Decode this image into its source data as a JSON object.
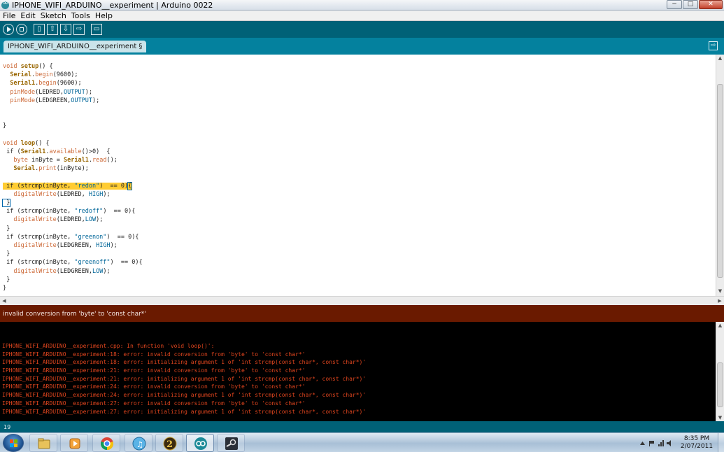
{
  "window": {
    "title": "IPHONE_WIFI_ARDUINO__experiment | Arduino 0022",
    "minimize": "−",
    "maximize": "□",
    "close": "✕"
  },
  "menu": [
    "File",
    "Edit",
    "Sketch",
    "Tools",
    "Help"
  ],
  "toolbar": {
    "icons": [
      "verify-icon",
      "stop-icon",
      "new-icon",
      "open-icon",
      "save-icon",
      "upload-icon",
      "serial-monitor-icon"
    ]
  },
  "tab": {
    "label": "IPHONE_WIFI_ARDUINO__experiment §"
  },
  "code": {
    "l1_a": "void ",
    "l1_b": "setup",
    "l1_c": "() {",
    "l2_a": "  ",
    "l2_b": "Serial",
    "l2_c": ".",
    "l2_d": "begin",
    "l2_e": "(9600);",
    "l3_a": "  ",
    "l3_b": "Serial1",
    "l3_c": ".",
    "l3_d": "begin",
    "l3_e": "(9600);",
    "l4_a": "  ",
    "l4_b": "pinMode",
    "l4_c": "(LEDRED,",
    "l4_d": "OUTPUT",
    "l4_e": ");",
    "l5_a": "  ",
    "l5_b": "pinMode",
    "l5_c": "(LEDGREEN,",
    "l5_d": "OUTPUT",
    "l5_e": ");",
    "l8": "}",
    "l10_a": "void ",
    "l10_b": "loop",
    "l10_c": "() {",
    "l11_a": " if (",
    "l11_b": "Serial1",
    "l11_c": ".",
    "l11_d": "available",
    "l11_e": "()>0)  {",
    "l12_a": "   ",
    "l12_b": "byte",
    "l12_c": " inByte = ",
    "l12_d": "Serial1",
    "l12_e": ".",
    "l12_f": "read",
    "l12_g": "();",
    "l13_a": "   ",
    "l13_b": "Serial",
    "l13_c": ".",
    "l13_d": "print",
    "l13_e": "(inByte);",
    "l15_a": " if (strcmp(inByte, ",
    "l15_b": "\"redon\"",
    "l15_c": ")  == 0)",
    "l15_d": "{",
    "l16_a": "   ",
    "l16_b": "digitalWrite",
    "l16_c": "(LEDRED, ",
    "l16_d": "HIGH",
    "l16_e": ");",
    "l17": " }",
    "l18_a": " if (strcmp(inByte, ",
    "l18_b": "\"redoff\"",
    "l18_c": ")  == 0){",
    "l19_a": "   ",
    "l19_b": "digitalWrite",
    "l19_c": "(LEDRED,",
    "l19_d": "LOW",
    "l19_e": ");",
    "l20": " }",
    "l21_a": " if (strcmp(inByte, ",
    "l21_b": "\"greenon\"",
    "l21_c": ")  == 0){",
    "l22_a": "   ",
    "l22_b": "digitalWrite",
    "l22_c": "(LEDGREEN, ",
    "l22_d": "HIGH",
    "l22_e": ");",
    "l23": " }",
    "l24_a": " if (strcmp(inByte, ",
    "l24_b": "\"greenoff\"",
    "l24_c": ")  == 0){",
    "l25_a": "   ",
    "l25_b": "digitalWrite",
    "l25_c": "(LEDGREEN,",
    "l25_d": "LOW",
    "l25_e": ");",
    "l26": " }",
    "l27": "}"
  },
  "status": {
    "message": "invalid conversion from 'byte' to 'const char*'"
  },
  "console": {
    "lines": [
      "IPHONE_WIFI_ARDUINO__experiment.cpp: In function 'void loop()':",
      "IPHONE_WIFI_ARDUINO__experiment:18: error: invalid conversion from 'byte' to 'const char*'",
      "IPHONE_WIFI_ARDUINO__experiment:18: error: initializing argument 1 of 'int strcmp(const char*, const char*)'",
      "IPHONE_WIFI_ARDUINO__experiment:21: error: invalid conversion from 'byte' to 'const char*'",
      "IPHONE_WIFI_ARDUINO__experiment:21: error: initializing argument 1 of 'int strcmp(const char*, const char*)'",
      "IPHONE_WIFI_ARDUINO__experiment:24: error: invalid conversion from 'byte' to 'const char*'",
      "IPHONE_WIFI_ARDUINO__experiment:24: error: initializing argument 1 of 'int strcmp(const char*, const char*)'",
      "IPHONE_WIFI_ARDUINO__experiment:27: error: invalid conversion from 'byte' to 'const char*'",
      "IPHONE_WIFI_ARDUINO__experiment:27: error: initializing argument 1 of 'int strcmp(const char*, const char*)'"
    ]
  },
  "line_number": "19",
  "taskbar": {
    "items": [
      "windows-explorer-icon",
      "media-player-icon",
      "chrome-icon",
      "itunes-icon",
      "game-2-icon",
      "arduino-icon",
      "steam-icon"
    ],
    "time": "8:35 PM",
    "date": "2/07/2011"
  },
  "colors": {
    "toolbar": "#006177",
    "tabbar": "#04819e",
    "status_bar": "#6a1a00",
    "error_text": "#e0451e",
    "highlight": "#ffcc33"
  }
}
